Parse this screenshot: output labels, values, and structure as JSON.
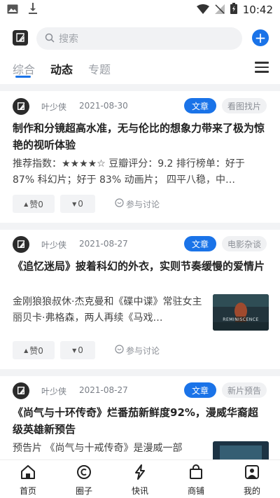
{
  "status_bar": {
    "time": "10:42"
  },
  "search": {
    "placeholder": "搜索"
  },
  "tabs": [
    {
      "label": "综合",
      "active": false
    },
    {
      "label": "动态",
      "active": true
    },
    {
      "label": "专题",
      "active": false
    }
  ],
  "colors": {
    "accent": "#1a73e8",
    "tag_bg": "#f0f1f3",
    "divider": "#f2f3f5"
  },
  "cards": [
    {
      "author": "叶少侠",
      "date": "2021-08-30",
      "type_tag": "文章",
      "category": "看图找片",
      "title": "制作和分镜超高水准，无与伦比的想象力带来了极为惊艳的视听体验",
      "excerpt": "推荐指数：★★★★☆ 豆瓣评分：9.2 排行榜单：好于 87% 科幻片；好于 83% 动画片； 四平八稳，中…",
      "like_label": "赞0",
      "dislike_label": "0",
      "discuss_label": "参与讨论"
    },
    {
      "author": "叶少侠",
      "date": "2021-08-27",
      "type_tag": "文章",
      "category": "电影杂谈",
      "title": "《追忆迷局》披着科幻的外衣，实则节奏缓慢的爱情片",
      "excerpt": "金刚狼狼叔休·杰克曼和《碟中谍》常驻女主丽贝卡·弗格森，两人再续《马戏…",
      "like_label": "赞0",
      "dislike_label": "0",
      "discuss_label": "参与讨论",
      "thumb_text": "REMINISCENCE"
    },
    {
      "author": "叶少侠",
      "date": "2021-08-27",
      "type_tag": "文章",
      "category": "新片预告",
      "title": "《尚气与十环传奇》烂番茄新鲜度92%，漫威华裔超级英雄新预告",
      "excerpt": "预告片 《尚气与十戒传奇》是漫威一部"
    }
  ],
  "bottom_nav": [
    {
      "label": "首页",
      "icon": "home-icon"
    },
    {
      "label": "圈子",
      "icon": "circle-icon"
    },
    {
      "label": "快讯",
      "icon": "lightning-icon"
    },
    {
      "label": "商铺",
      "icon": "shopping-bag-icon"
    },
    {
      "label": "我的",
      "icon": "profile-icon"
    }
  ]
}
